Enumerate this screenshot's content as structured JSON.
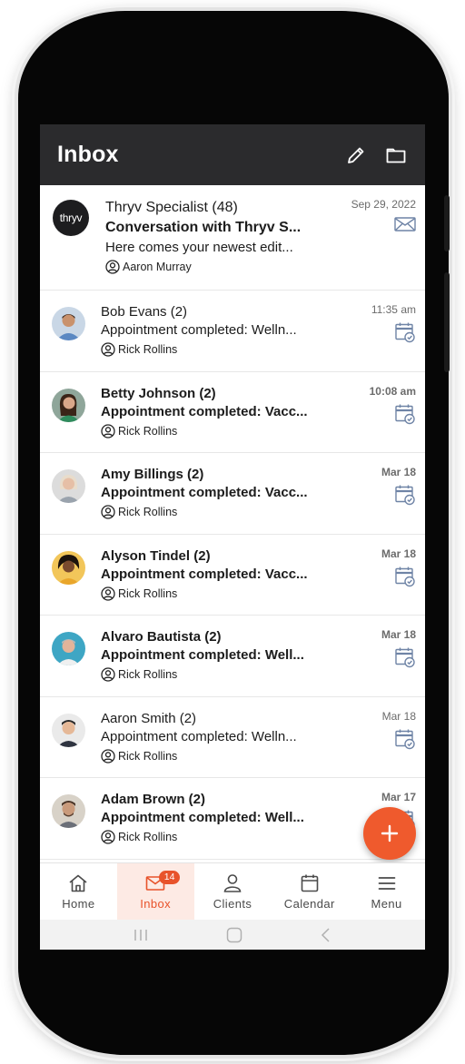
{
  "header": {
    "title": "Inbox",
    "icons": [
      "pencil-icon",
      "folder-icon"
    ]
  },
  "conversations": [
    {
      "name": "Thryv Specialist (48)",
      "subject": "Conversation with Thryv S...",
      "preview": "Here comes your newest edit...",
      "assignee": "Aaron Murray",
      "date": "Sep 29, 2022",
      "channel_icon": "email-icon",
      "logo_text": "thryv"
    },
    {
      "name": "Bob Evans (2)",
      "subject": "Appointment completed: Welln...",
      "assignee": "Rick Rollins",
      "date": "11:35 am",
      "channel_icon": "calendar-check-icon"
    },
    {
      "name": "Betty Johnson (2)",
      "subject": "Appointment completed: Vacc...",
      "assignee": "Rick Rollins",
      "date": "10:08 am",
      "channel_icon": "calendar-check-icon"
    },
    {
      "name": "Amy Billings (2)",
      "subject": "Appointment completed: Vacc...",
      "assignee": "Rick Rollins",
      "date": "Mar 18",
      "channel_icon": "calendar-check-icon"
    },
    {
      "name": "Alyson Tindel (2)",
      "subject": "Appointment completed: Vacc...",
      "assignee": "Rick Rollins",
      "date": "Mar 18",
      "channel_icon": "calendar-check-icon"
    },
    {
      "name": "Alvaro Bautista (2)",
      "subject": "Appointment completed: Well...",
      "assignee": "Rick Rollins",
      "date": "Mar 18",
      "channel_icon": "calendar-check-icon"
    },
    {
      "name": "Aaron Smith (2)",
      "subject": "Appointment completed: Welln...",
      "assignee": "Rick Rollins",
      "date": "Mar 18",
      "channel_icon": "calendar-check-icon"
    },
    {
      "name": "Adam Brown (2)",
      "subject": "Appointment completed: Well...",
      "assignee": "Rick Rollins",
      "date": "Mar 17",
      "channel_icon": "calendar-check-icon"
    }
  ],
  "nav": {
    "items": [
      {
        "label": "Home",
        "icon": "home-icon"
      },
      {
        "label": "Inbox",
        "icon": "inbox-icon",
        "badge": "14"
      },
      {
        "label": "Clients",
        "icon": "person-icon"
      },
      {
        "label": "Calendar",
        "icon": "calendar-icon"
      },
      {
        "label": "Menu",
        "icon": "hamburger-icon"
      }
    ]
  },
  "colors": {
    "header_bg": "#2b2b2d",
    "accent": "#e8532b",
    "fab": "#ef5a2d",
    "active_nav_bg": "#fdeae4",
    "channel_icon": "#6f84a6"
  }
}
